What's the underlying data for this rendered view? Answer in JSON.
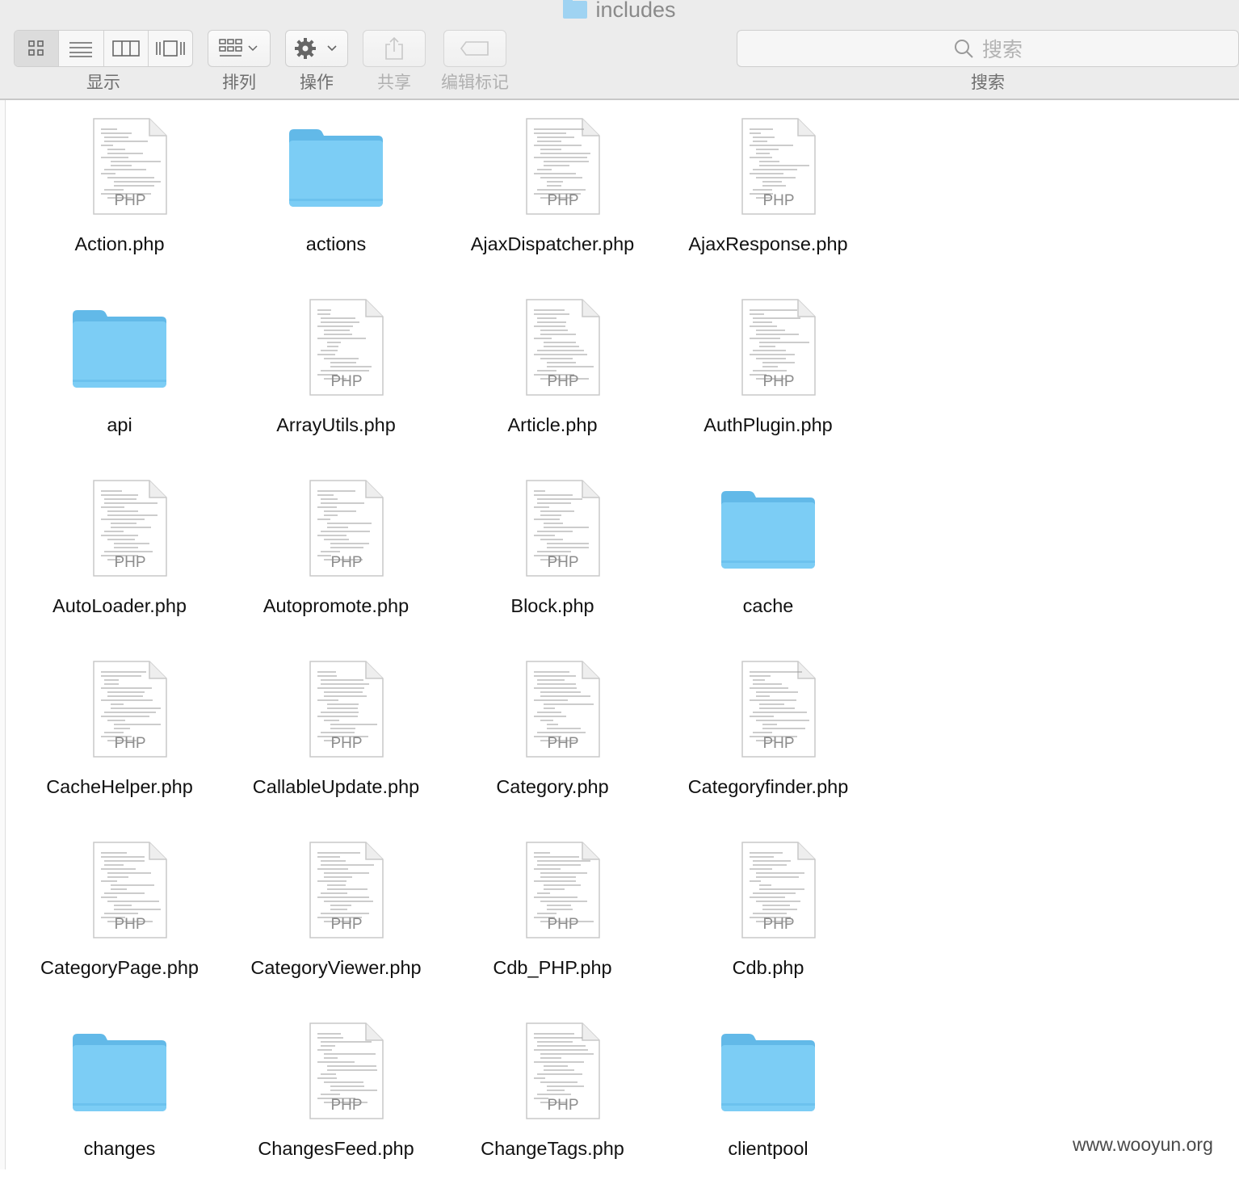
{
  "window": {
    "title": "includes"
  },
  "toolbar": {
    "view_label": "显示",
    "arrange_label": "排列",
    "action_label": "操作",
    "share_label": "共享",
    "tags_label": "编辑标记",
    "search_label": "搜索",
    "search_placeholder": "搜索"
  },
  "files": [
    {
      "name": "Action.php",
      "kind": "php"
    },
    {
      "name": "actions",
      "kind": "folder"
    },
    {
      "name": "AjaxDispatcher.php",
      "kind": "php"
    },
    {
      "name": "AjaxResponse.php",
      "kind": "php"
    },
    {
      "name": "api",
      "kind": "folder"
    },
    {
      "name": "ArrayUtils.php",
      "kind": "php"
    },
    {
      "name": "Article.php",
      "kind": "php"
    },
    {
      "name": "AuthPlugin.php",
      "kind": "php"
    },
    {
      "name": "AutoLoader.php",
      "kind": "php"
    },
    {
      "name": "Autopromote.php",
      "kind": "php"
    },
    {
      "name": "Block.php",
      "kind": "php"
    },
    {
      "name": "cache",
      "kind": "folder"
    },
    {
      "name": "CacheHelper.php",
      "kind": "php"
    },
    {
      "name": "CallableUpdate.php",
      "kind": "php"
    },
    {
      "name": "Category.php",
      "kind": "php"
    },
    {
      "name": "Categoryfinder.php",
      "kind": "php"
    },
    {
      "name": "CategoryPage.php",
      "kind": "php"
    },
    {
      "name": "CategoryViewer.php",
      "kind": "php"
    },
    {
      "name": "Cdb_PHP.php",
      "kind": "php"
    },
    {
      "name": "Cdb.php",
      "kind": "php"
    },
    {
      "name": "changes",
      "kind": "folder"
    },
    {
      "name": "ChangesFeed.php",
      "kind": "php"
    },
    {
      "name": "ChangeTags.php",
      "kind": "php"
    },
    {
      "name": "clientpool",
      "kind": "folder"
    }
  ],
  "php_badge": "PHP",
  "watermark": "www.wooyun.org",
  "colors": {
    "folder": "#7ccdf5",
    "toolbar_bg": "#ececec"
  }
}
